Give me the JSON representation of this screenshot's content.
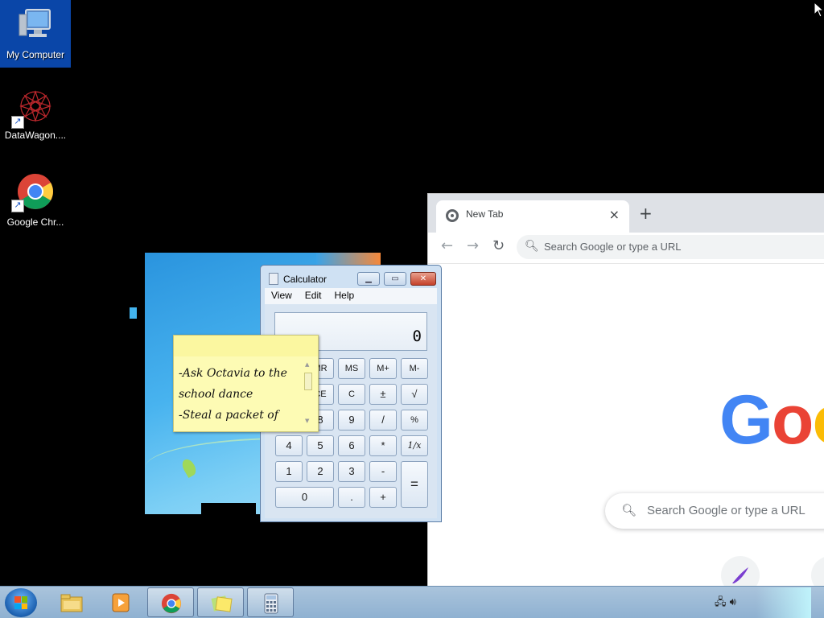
{
  "desktop": {
    "icons": [
      {
        "label": "My Computer",
        "icon": "computer-icon"
      },
      {
        "label": "DataWagon....",
        "icon": "datawagon-icon"
      },
      {
        "label": "Google Chr...",
        "icon": "chrome-icon"
      }
    ]
  },
  "chrome": {
    "tab_title": "New Tab",
    "tab_close": "×",
    "new_tab": "+",
    "back": "←",
    "forward": "→",
    "reload": "↻",
    "omnibox_placeholder": "Search Google or type a URL",
    "logo_letters": [
      "G",
      "o",
      "o"
    ],
    "logo_colors": [
      "#4285F4",
      "#EA4335",
      "#FBBC05"
    ],
    "search_placeholder": "Search Google or type a URL"
  },
  "calculator": {
    "title": "Calculator",
    "menu": [
      "View",
      "Edit",
      "Help"
    ],
    "display": "0",
    "keys": {
      "mr": "MR",
      "ms": "MS",
      "mplus": "M+",
      "mminus": "M-",
      "ce": "CE",
      "c": "C",
      "plusminus": "±",
      "sqrt": "√",
      "k8": "8",
      "k9": "9",
      "div": "/",
      "pct": "%",
      "k4": "4",
      "k5": "5",
      "k6": "6",
      "mul": "*",
      "recip": "1/x",
      "k1": "1",
      "k2": "2",
      "k3": "3",
      "sub": "-",
      "k0": "0",
      "dot": ".",
      "add": "+",
      "eq": "="
    }
  },
  "sticky": {
    "lines": [
      "-Ask Octavia to the",
      "school dance",
      "-Steal a packet of"
    ]
  },
  "taskbar": {
    "items": [
      {
        "name": "explorer",
        "icon": "folder-icon"
      },
      {
        "name": "media",
        "icon": "media-player-icon"
      },
      {
        "name": "chrome",
        "icon": "chrome-icon"
      },
      {
        "name": "sticky-notes",
        "icon": "sticky-notes-icon"
      },
      {
        "name": "calculator",
        "icon": "calculator-icon"
      }
    ]
  }
}
